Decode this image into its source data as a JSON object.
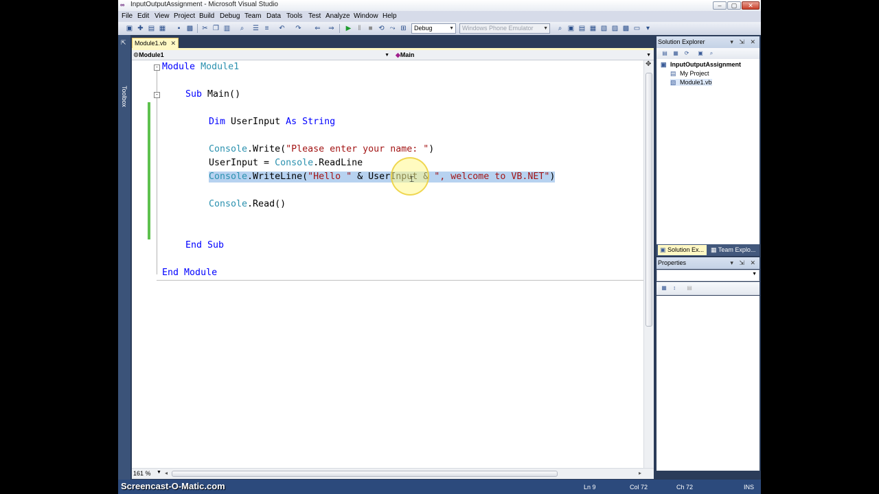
{
  "window": {
    "title": "InputOutputAssignment - Microsoft Visual Studio",
    "app_icon": "visual-studio-icon",
    "controls": [
      "minimize",
      "maximize",
      "close"
    ]
  },
  "menu": [
    "File",
    "Edit",
    "View",
    "Project",
    "Build",
    "Debug",
    "Team",
    "Data",
    "Tools",
    "Test",
    "Analyze",
    "Window",
    "Help"
  ],
  "toolbar": {
    "config": "Debug",
    "target": "Windows Phone Emulator"
  },
  "toolbox_label": "Toolbox",
  "editor": {
    "tab_label": "Module1.vb",
    "nav_left": "Module1",
    "nav_right": "Main",
    "zoom": "161 %",
    "code": {
      "l1_kw": "Module",
      "l1_name": "Module1",
      "l2_kw": "Sub",
      "l2_rest": " Main()",
      "l3_dim": "Dim",
      "l3_var": " UserInput ",
      "l3_as": "As",
      "l3_type": "String",
      "l4_cls": "Console",
      "l4_mid": ".Write(",
      "l4_str": "\"Please enter your name: \"",
      "l4_end": ")",
      "l5_lhs": "UserInput = ",
      "l5_cls": "Console",
      "l5_end": ".ReadLine",
      "l6_cls": "Console",
      "l6_mid": ".WriteLine(",
      "l6_str1": "\"Hello \"",
      "l6_amp1": " & UserInput & ",
      "l6_str2": "\", welcome to VB.NET\"",
      "l6_end": ")",
      "l7_cls": "Console",
      "l7_end": ".Read()",
      "l8_end": "End",
      "l8_sub": "Sub",
      "l9_end": "End",
      "l9_module": "Module"
    }
  },
  "solution_explorer": {
    "title": "Solution Explorer",
    "items": [
      "InputOutputAssignment",
      "My Project",
      "Module1.vb"
    ],
    "tabs": [
      "Solution Ex...",
      "Team Explo..."
    ]
  },
  "properties": {
    "title": "Properties"
  },
  "status": {
    "ln": "Ln 9",
    "col": "Col 72",
    "ch": "Ch 72",
    "mode": "INS"
  },
  "watermark": "Screencast-O-Matic.com"
}
